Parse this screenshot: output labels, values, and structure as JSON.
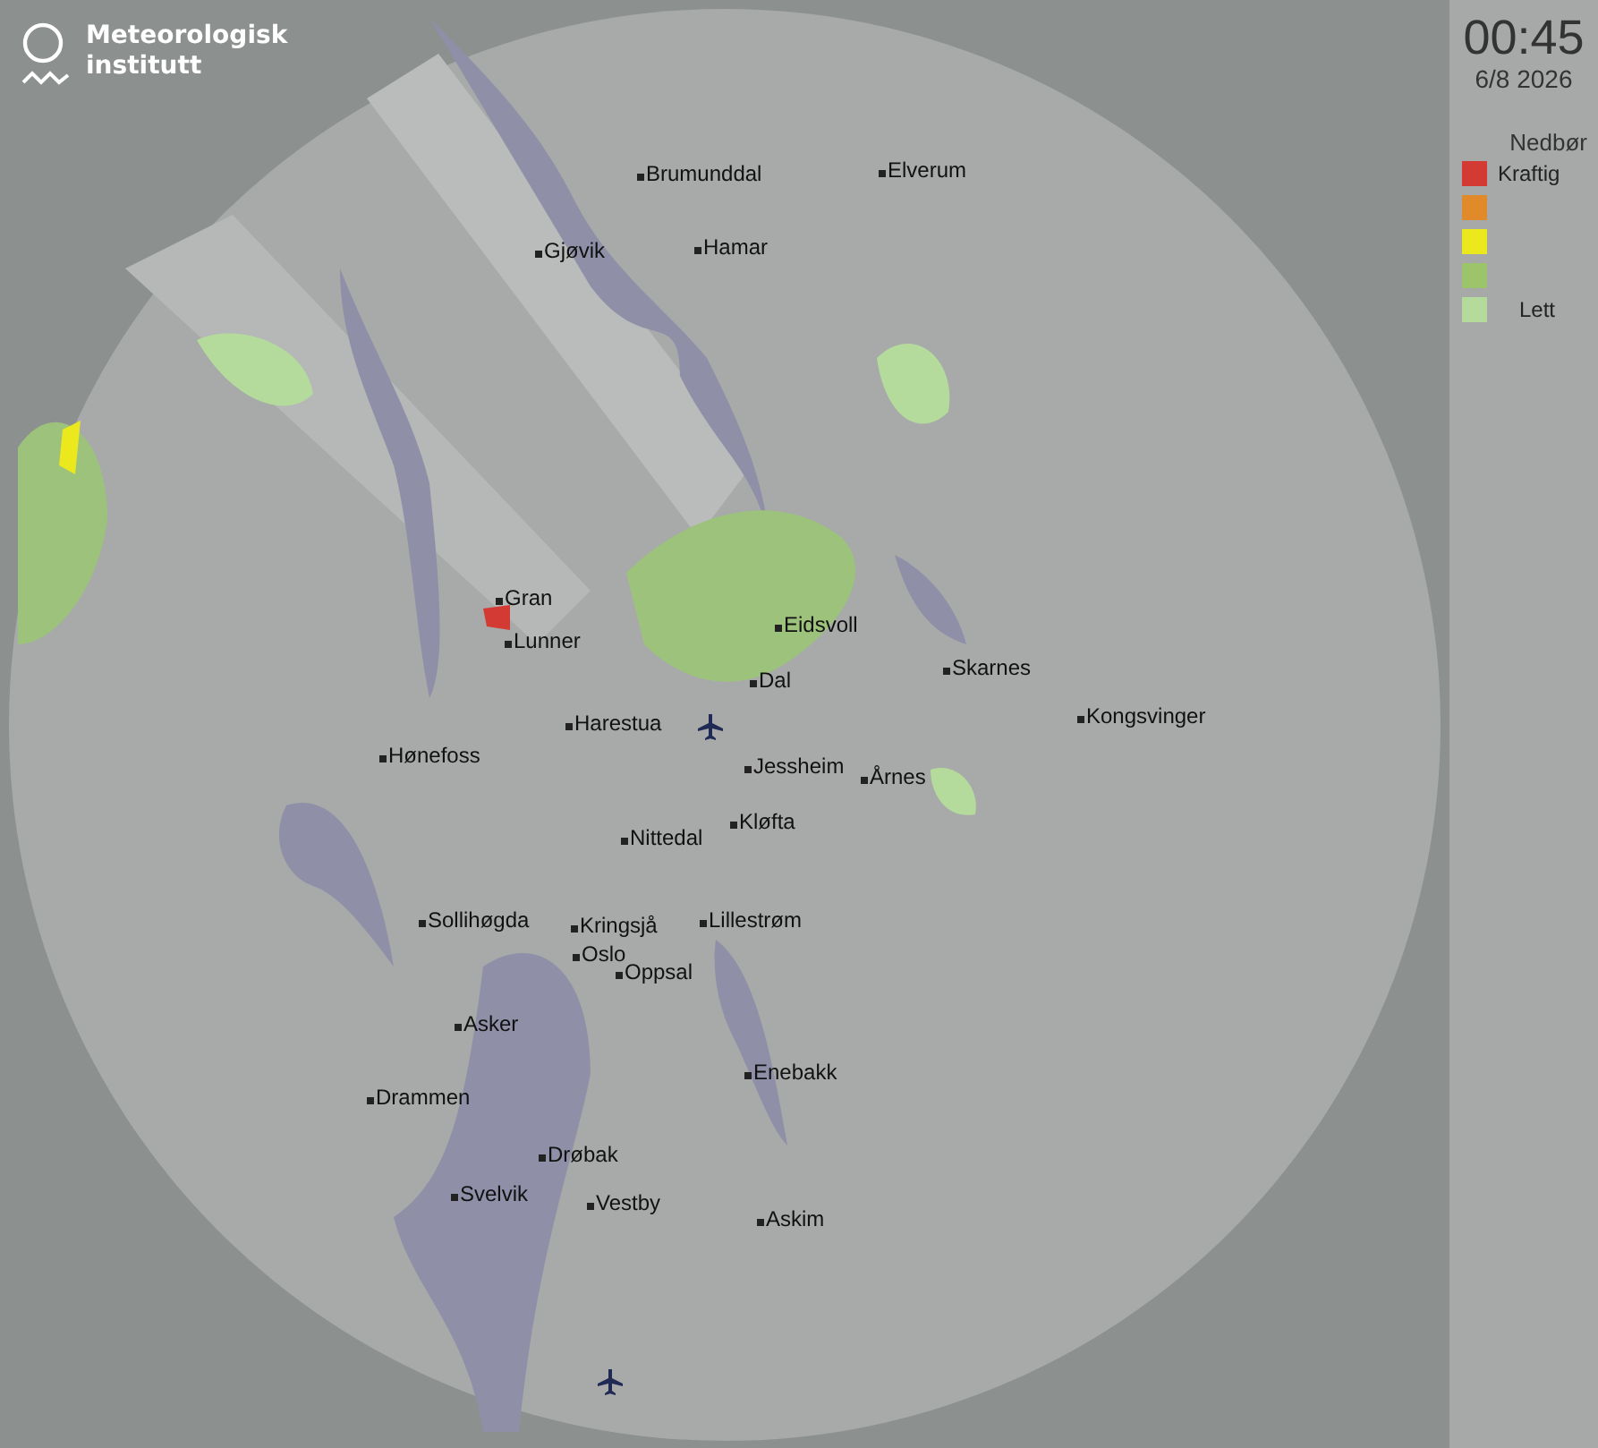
{
  "logo": {
    "line_1": "Meteorologisk",
    "line_2": "institutt"
  },
  "time": "00:45",
  "date": "6/8 2026",
  "legend": {
    "title": "Nedbør",
    "items": [
      {
        "color": "#d43a34",
        "label": "Kraftig"
      },
      {
        "color": "#e08a2a"
      },
      {
        "color": "#ece81e"
      },
      {
        "color": "#9cc46a"
      },
      {
        "color": "#b4da9c",
        "label": "Lett"
      }
    ]
  },
  "places": [
    "Brumunddal",
    "Elverum",
    "Gjøvik",
    "Hamar",
    "Gran",
    "Lunner",
    "Eidsvoll",
    "Dal",
    "Skarnes",
    "Kongsvinger",
    "Harestua",
    "Hønefoss",
    "Jessheim",
    "Årnes",
    "Kløfta",
    "Nittedal",
    "Sollihøgda",
    "Kringsjå",
    "Lillestrøm",
    "Oslo",
    "Oppsal",
    "Asker",
    "Enebakk",
    "Drammen",
    "Drøbak",
    "Svelvik",
    "Vestby",
    "Askim"
  ]
}
